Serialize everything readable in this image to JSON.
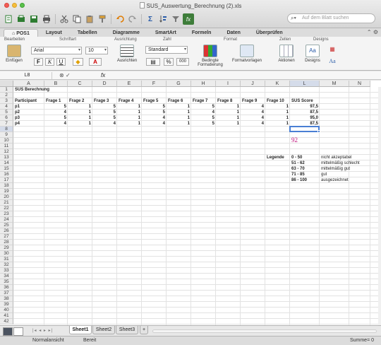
{
  "window": {
    "title": "SUS_Auswertung_Berechnung (2).xls",
    "search_placeholder": "Auf dem Blatt suchen"
  },
  "toolbar": {
    "icons": [
      "new-icon",
      "open-icon",
      "save-icon",
      "print-icon",
      "cut-icon",
      "copy-icon",
      "paste-icon",
      "format-painter-icon",
      "undo-icon",
      "redo-icon",
      "autosum-icon",
      "sort-icon",
      "filter-icon",
      "formula-builder-icon"
    ],
    "sum_symbol": "Σ",
    "formula_symbol": "fx"
  },
  "ribbon": {
    "tabs": [
      "POS1",
      "Layout",
      "Tabellen",
      "Diagramme",
      "SmartArt",
      "Formeln",
      "Daten",
      "Überprüfen"
    ],
    "active_tab": "POS1",
    "groups": {
      "bearbeiten": "Bearbeiten",
      "schriftart": "Schriftart",
      "ausrichtung": "Ausrichtung",
      "zahl": "Zahl",
      "format": "Format",
      "zellen": "Zellen",
      "designs": "Designs"
    },
    "einfuegen_label": "Einfügen",
    "font_name": "Arial",
    "font_size": "10",
    "bold": "F",
    "italic": "K",
    "underline": "U",
    "ausrichten_label": "Ausrichten",
    "number_format": "Standard",
    "percent": "%",
    "thousands": "000",
    "bedingte_label1": "Bedingte",
    "bedingte_label2": "Formatierung",
    "formatvorlagen_label": "Formatvorlagen",
    "aktionen_label": "Aktionen",
    "designs_label": "Designs",
    "aa_label": "Aa"
  },
  "formula_bar": {
    "cell_ref": "L8",
    "fx": "fx",
    "content": ""
  },
  "sheet": {
    "columns": [
      "A",
      "B",
      "C",
      "D",
      "E",
      "F",
      "G",
      "H",
      "I",
      "J",
      "K",
      "L",
      "M",
      "N"
    ],
    "selected_column": "L",
    "selected_row": 8,
    "row_count": 42,
    "title_cell": "SUS Berechnung",
    "headers": [
      "Participant",
      "Frage 1",
      "Frage 2",
      "Frage 3",
      "Frage 4",
      "Frage 5",
      "Frage 6",
      "Frage 7",
      "Frage 8",
      "Frage 9",
      "Frage 10",
      "SUS Score"
    ],
    "rows": [
      {
        "participant": "p1",
        "values": [
          "5",
          "1",
          "5",
          "1",
          "5",
          "1",
          "5",
          "1",
          "4",
          "1"
        ],
        "score": "97,5"
      },
      {
        "participant": "p2",
        "values": [
          "4",
          "1",
          "5",
          "1",
          "5",
          "1",
          "4",
          "1",
          "4",
          "1"
        ],
        "score": "87,5"
      },
      {
        "participant": "p3",
        "values": [
          "5",
          "1",
          "5",
          "1",
          "4",
          "1",
          "5",
          "1",
          "4",
          "1"
        ],
        "score": "95,0"
      },
      {
        "participant": "p4",
        "values": [
          "4",
          "1",
          "4",
          "1",
          "4",
          "1",
          "5",
          "1",
          "4",
          "1"
        ],
        "score": "87,5"
      }
    ],
    "annotation": "92",
    "legend_label": "Legende",
    "legend": [
      {
        "range": "0 - 50",
        "text": "nicht akzeptabel"
      },
      {
        "range": "51 - 62",
        "text": "mittelmäßig schlecht"
      },
      {
        "range": "63 - 70",
        "text": "mittelmäßig gut"
      },
      {
        "range": "71 - 85",
        "text": "gut"
      },
      {
        "range": "86 - 100",
        "text": "ausgezeichnet"
      }
    ]
  },
  "sheet_tabs": [
    "Sheet1",
    "Sheet2",
    "Sheet3"
  ],
  "active_sheet": "Sheet1",
  "add_sheet": "+",
  "statusbar": {
    "view": "Normalansicht",
    "status": "Bereit",
    "sum": "Summe= 0"
  },
  "colors": {
    "accent": "#4a7fd4",
    "annotation": "#c0137e",
    "header_bg": "#ececec"
  }
}
